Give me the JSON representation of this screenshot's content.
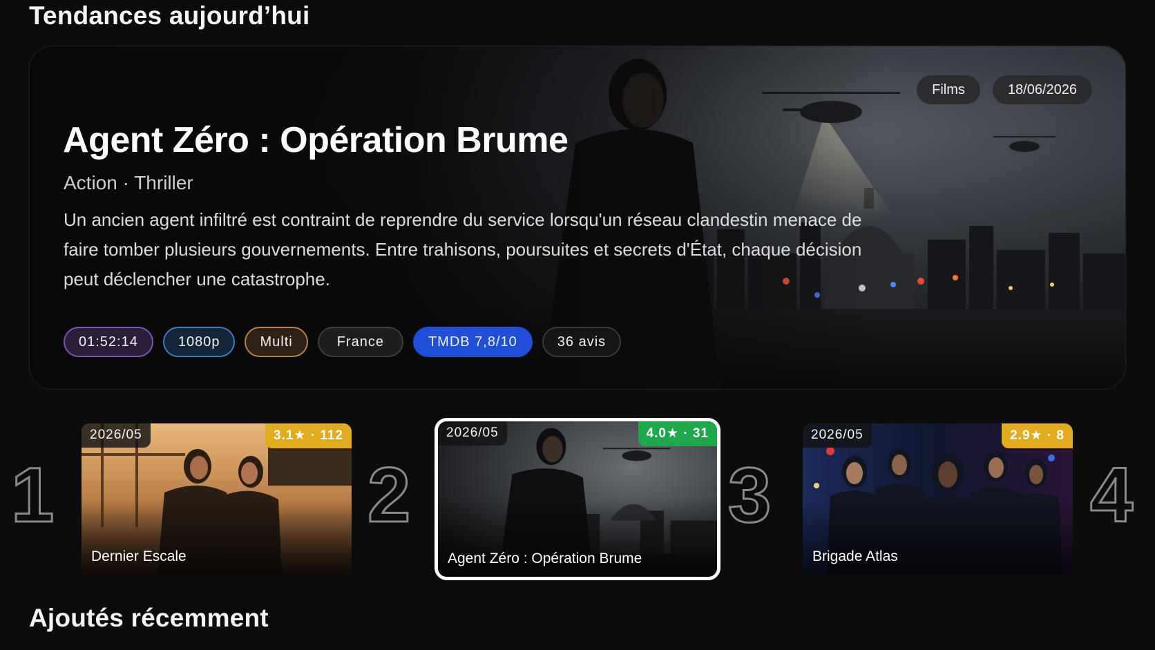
{
  "sections": {
    "trending_title": "Tendances aujourd’hui",
    "recent_title": "Ajoutés récemment"
  },
  "hero": {
    "title": "Agent Zéro : Opération Brume",
    "genres": "Action · Thriller",
    "description": "Un ancien agent infiltré est contraint de reprendre du service lorsqu'un réseau clandestin menace de faire tomber plusieurs gouvernements. Entre trahisons, poursuites et secrets d'État, chaque décision peut déclencher une catastrophe.",
    "category_tag": "Films",
    "date_tag": "18/06/2026",
    "chips": {
      "runtime": "01:52:14",
      "quality": "1080p",
      "audio": "Multi",
      "country": "France",
      "tmdb": "TMDB 7,8/10",
      "reviews": "36 avis"
    }
  },
  "ranking": [
    {
      "rank": "1",
      "date": "2026/05",
      "rating": "3.1★ · 112",
      "title": "Dernier Escale",
      "rating_color": "#e3ab1e",
      "selected": false
    },
    {
      "rank": "2",
      "date": "2026/05",
      "rating": "4.0★ · 31",
      "title": "Agent Zéro : Opération Brume",
      "rating_color": "#1fa84a",
      "selected": true
    },
    {
      "rank": "3",
      "date": "2026/05",
      "rating": "2.9★ · 8",
      "title": "Brigade Atlas",
      "rating_color": "#e3ab1e",
      "selected": false
    },
    {
      "rank": "4"
    }
  ]
}
